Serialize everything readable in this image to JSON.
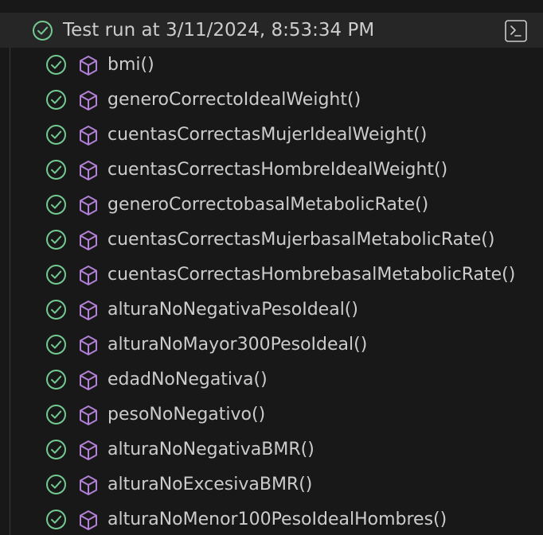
{
  "run": {
    "title": "Test run at 3/11/2024, 8:53:34 PM",
    "status_icon": "check-circle-icon",
    "action_icon": "terminal-icon"
  },
  "colors": {
    "pass": "#73c991",
    "method": "#b180d7",
    "text": "#cccccc",
    "header_bg": "#262626",
    "panel_bg": "#181818"
  },
  "tests": [
    {
      "name": "bmi()"
    },
    {
      "name": "generoCorrectoIdealWeight()"
    },
    {
      "name": "cuentasCorrectasMujerIdealWeight()"
    },
    {
      "name": "cuentasCorrectasHombreIdealWeight()"
    },
    {
      "name": "generoCorrectobasalMetabolicRate()"
    },
    {
      "name": "cuentasCorrectasMujerbasalMetabolicRate()"
    },
    {
      "name": "cuentasCorrectasHombrebasalMetabolicRate()"
    },
    {
      "name": "alturaNoNegativaPesoIdeal()"
    },
    {
      "name": "alturaNoMayor300PesoIdeal()"
    },
    {
      "name": "edadNoNegativa()"
    },
    {
      "name": "pesoNoNegativo()"
    },
    {
      "name": "alturaNoNegativaBMR()"
    },
    {
      "name": "alturaNoExcesivaBMR()"
    },
    {
      "name": "alturaNoMenor100PesoIdealHombres()"
    }
  ]
}
